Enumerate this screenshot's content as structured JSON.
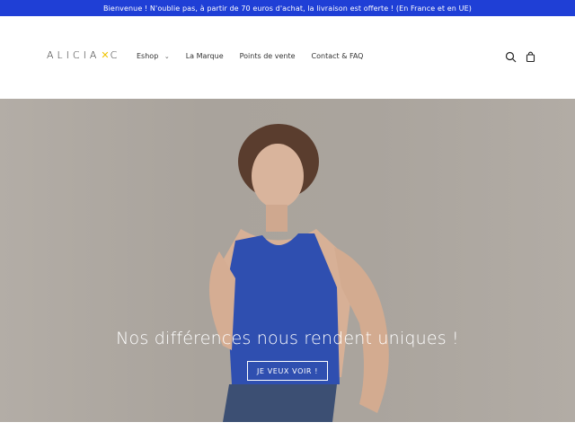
{
  "announcement": {
    "text": "Bienvenue ! N'oublie pas, à partir de 70 euros d'achat, la livraison est offerte ! (En France et en UE)"
  },
  "header": {
    "logo_text_before": "ALICIA",
    "logo_mark": "✕",
    "logo_text_after": "C",
    "nav": [
      {
        "label": "Eshop"
      },
      {
        "label": "La Marque"
      },
      {
        "label": "Points de vente"
      },
      {
        "label": "Contact & FAQ"
      }
    ],
    "icons": {
      "search": "search-icon",
      "cart": "cart-icon",
      "dropdown": "chevron-down-icon"
    }
  },
  "hero": {
    "title": "Nos différences nous rendent uniques !",
    "button_label": "JE VEUX VOIR !"
  },
  "colors": {
    "announcement_bg": "#1f3fd6",
    "hero_bg": "#aaa49d",
    "logo_accent": "#f0c400",
    "top_blue": "#2247d8"
  }
}
